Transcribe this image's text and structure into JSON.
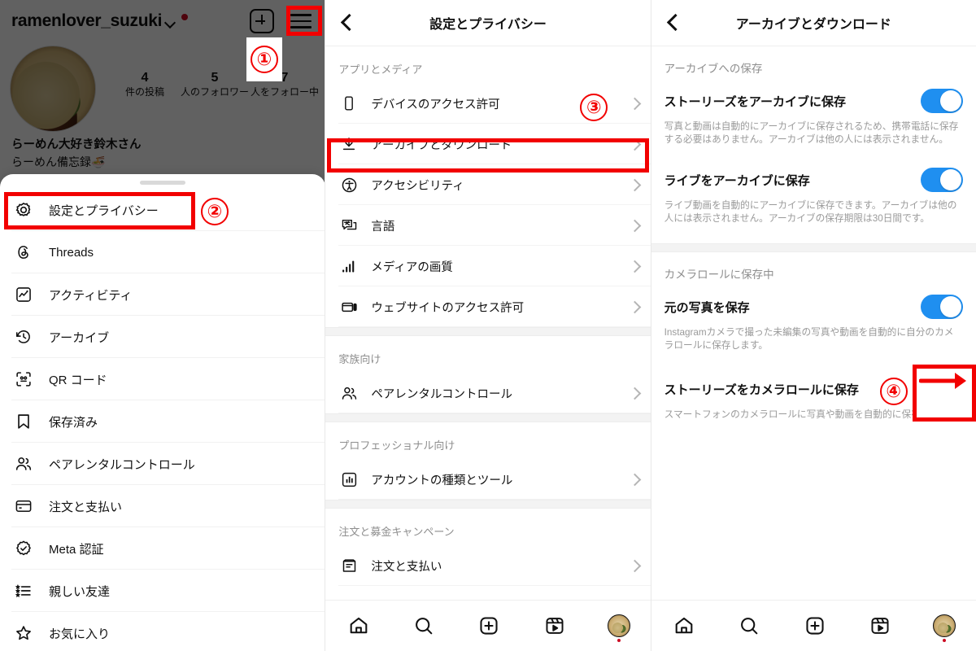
{
  "panel1": {
    "profile": {
      "username": "ramenlover_suzuki",
      "stats": [
        {
          "number": "4",
          "label": "件の投稿"
        },
        {
          "number": "5",
          "label": "人のフォロワー"
        },
        {
          "number": "7",
          "label": "人をフォロー中"
        }
      ],
      "display_name": "らーめん大好き鈴木さん",
      "bio": "らーめん備忘録🍜",
      "new_post_icon": "plus-box-icon",
      "menu_icon": "hamburger-menu-icon",
      "dropdown_icon": "chevron-down-icon",
      "notification_dot": "red-dot-icon",
      "avatar_icon": "profile-avatar-ramen"
    },
    "sheet": {
      "items": [
        {
          "label": "設定とプライバシー",
          "icon": "gear-icon"
        },
        {
          "label": "Threads",
          "icon": "threads-icon"
        },
        {
          "label": "アクティビティ",
          "icon": "activity-chart-icon"
        },
        {
          "label": "アーカイブ",
          "icon": "clock-history-icon"
        },
        {
          "label": "QR コード",
          "icon": "qr-code-icon"
        },
        {
          "label": "保存済み",
          "icon": "bookmark-icon"
        },
        {
          "label": "ペアレンタルコントロール",
          "icon": "people-icon"
        },
        {
          "label": "注文と支払い",
          "icon": "credit-card-icon"
        },
        {
          "label": "Meta 認証",
          "icon": "verified-badge-icon"
        },
        {
          "label": "親しい友達",
          "icon": "close-friends-list-icon"
        },
        {
          "label": "お気に入り",
          "icon": "star-icon"
        }
      ]
    }
  },
  "panel2": {
    "nav": {
      "title": "設定とプライバシー",
      "back_icon": "chevron-left-icon"
    },
    "sections": [
      {
        "header": "アプリとメディア",
        "items": [
          {
            "label": "デバイスのアクセス許可",
            "icon": "phone-icon",
            "chevron": "chevron-right-icon"
          },
          {
            "label": "アーカイブとダウンロード",
            "icon": "download-icon",
            "chevron": "chevron-right-icon"
          },
          {
            "label": "アクセシビリティ",
            "icon": "accessibility-icon",
            "chevron": "chevron-right-icon"
          },
          {
            "label": "言語",
            "icon": "language-icon",
            "chevron": "chevron-right-icon"
          },
          {
            "label": "メディアの画質",
            "icon": "signal-bars-icon",
            "chevron": "chevron-right-icon"
          },
          {
            "label": "ウェブサイトのアクセス許可",
            "icon": "browser-icon",
            "chevron": "chevron-right-icon"
          }
        ]
      },
      {
        "header": "家族向け",
        "items": [
          {
            "label": "ペアレンタルコントロール",
            "icon": "people-icon",
            "chevron": "chevron-right-icon"
          }
        ]
      },
      {
        "header": "プロフェッショナル向け",
        "items": [
          {
            "label": "アカウントの種類とツール",
            "icon": "bar-chart-icon",
            "chevron": "chevron-right-icon"
          }
        ]
      },
      {
        "header": "注文と募金キャンペーン",
        "items": [
          {
            "label": "注文と支払い",
            "icon": "receipt-icon",
            "chevron": "chevron-right-icon"
          }
        ]
      }
    ]
  },
  "panel3": {
    "nav": {
      "title": "アーカイブとダウンロード",
      "back_icon": "chevron-left-icon"
    },
    "groups": [
      {
        "header": "アーカイブへの保存",
        "rows": [
          {
            "label": "ストーリーズをアーカイブに保存",
            "toggle": "on",
            "desc": "写真と動画は自動的にアーカイブに保存されるため、携帯電話に保存する必要はありません。アーカイブは他の人には表示されません。"
          },
          {
            "label": "ライブをアーカイブに保存",
            "toggle": "on",
            "desc": "ライブ動画を自動的にアーカイブに保存できます。アーカイブは他の人には表示されません。アーカイブの保存期限は30日間です。"
          }
        ]
      },
      {
        "header": "カメラロールに保存中",
        "rows": [
          {
            "label": "元の写真を保存",
            "toggle": "on",
            "desc": "Instagramカメラで撮った未編集の写真や動画を自動的に自分のカメラロールに保存します。"
          },
          {
            "label": "ストーリーズをカメラロールに保存",
            "toggle": "on",
            "desc": "スマートフォンのカメラロールに写真や動画を自動的に保存します。"
          }
        ]
      }
    ]
  },
  "tabbar": {
    "items": [
      {
        "icon": "home-icon"
      },
      {
        "icon": "search-icon"
      },
      {
        "icon": "create-plus-icon"
      },
      {
        "icon": "reels-icon"
      },
      {
        "icon": "profile-avatar-icon"
      }
    ]
  },
  "annotations": {
    "colors": {
      "accent_red": "#f20000",
      "toggle_blue": "#1f8ff0"
    },
    "markers": [
      {
        "number": "①",
        "target": "hamburger-menu-icon"
      },
      {
        "number": "②",
        "target": "設定とプライバシー"
      },
      {
        "number": "③",
        "target": "アーカイブとダウンロード"
      },
      {
        "number": "④",
        "target": "ストーリーズをカメラロールに保存"
      }
    ]
  }
}
